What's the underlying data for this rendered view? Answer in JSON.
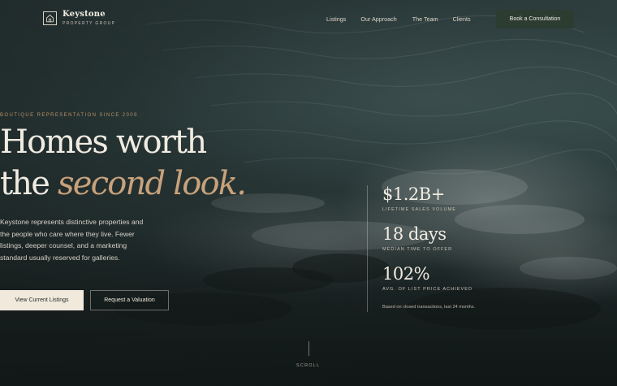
{
  "brand": {
    "name": "Keystone",
    "sub": "PROPERTY GROUP",
    "icon": "house-icon"
  },
  "nav": {
    "items": [
      {
        "label": "Listings"
      },
      {
        "label": "Our Approach"
      },
      {
        "label": "The Team"
      },
      {
        "label": "Clients"
      }
    ],
    "cta": "Book a Consultation"
  },
  "hero": {
    "eyebrow": "BOUTIQUE REPRESENTATION SINCE 2009",
    "headline_line1": "Homes worth",
    "headline_line2_plain": "the",
    "headline_line2_accent": "second look.",
    "lead": "Keystone represents distinctive properties and the people who care where they live. Fewer listings, deeper counsel, and a marketing standard usually reserved for galleries.",
    "primary_button": "View Current Listings",
    "secondary_button": "Request a Valuation"
  },
  "stats": {
    "items": [
      {
        "value": "$1.2B+",
        "label": "LIFETIME SALES VOLUME"
      },
      {
        "value": "18 days",
        "label": "MEDIAN TIME TO OFFER"
      },
      {
        "value": "102%",
        "label": "AVG. OF LIST PRICE ACHIEVED"
      }
    ],
    "note": "Based on closed transactions, last 24 months."
  },
  "scroll": {
    "label": "SCROLL"
  },
  "colors": {
    "accent": "#c7a27c",
    "eyebrow": "#b88f66",
    "cta_bg": "#2c3c31",
    "primary_button_bg": "#f0e9dc",
    "text": "#f0ebe2"
  }
}
